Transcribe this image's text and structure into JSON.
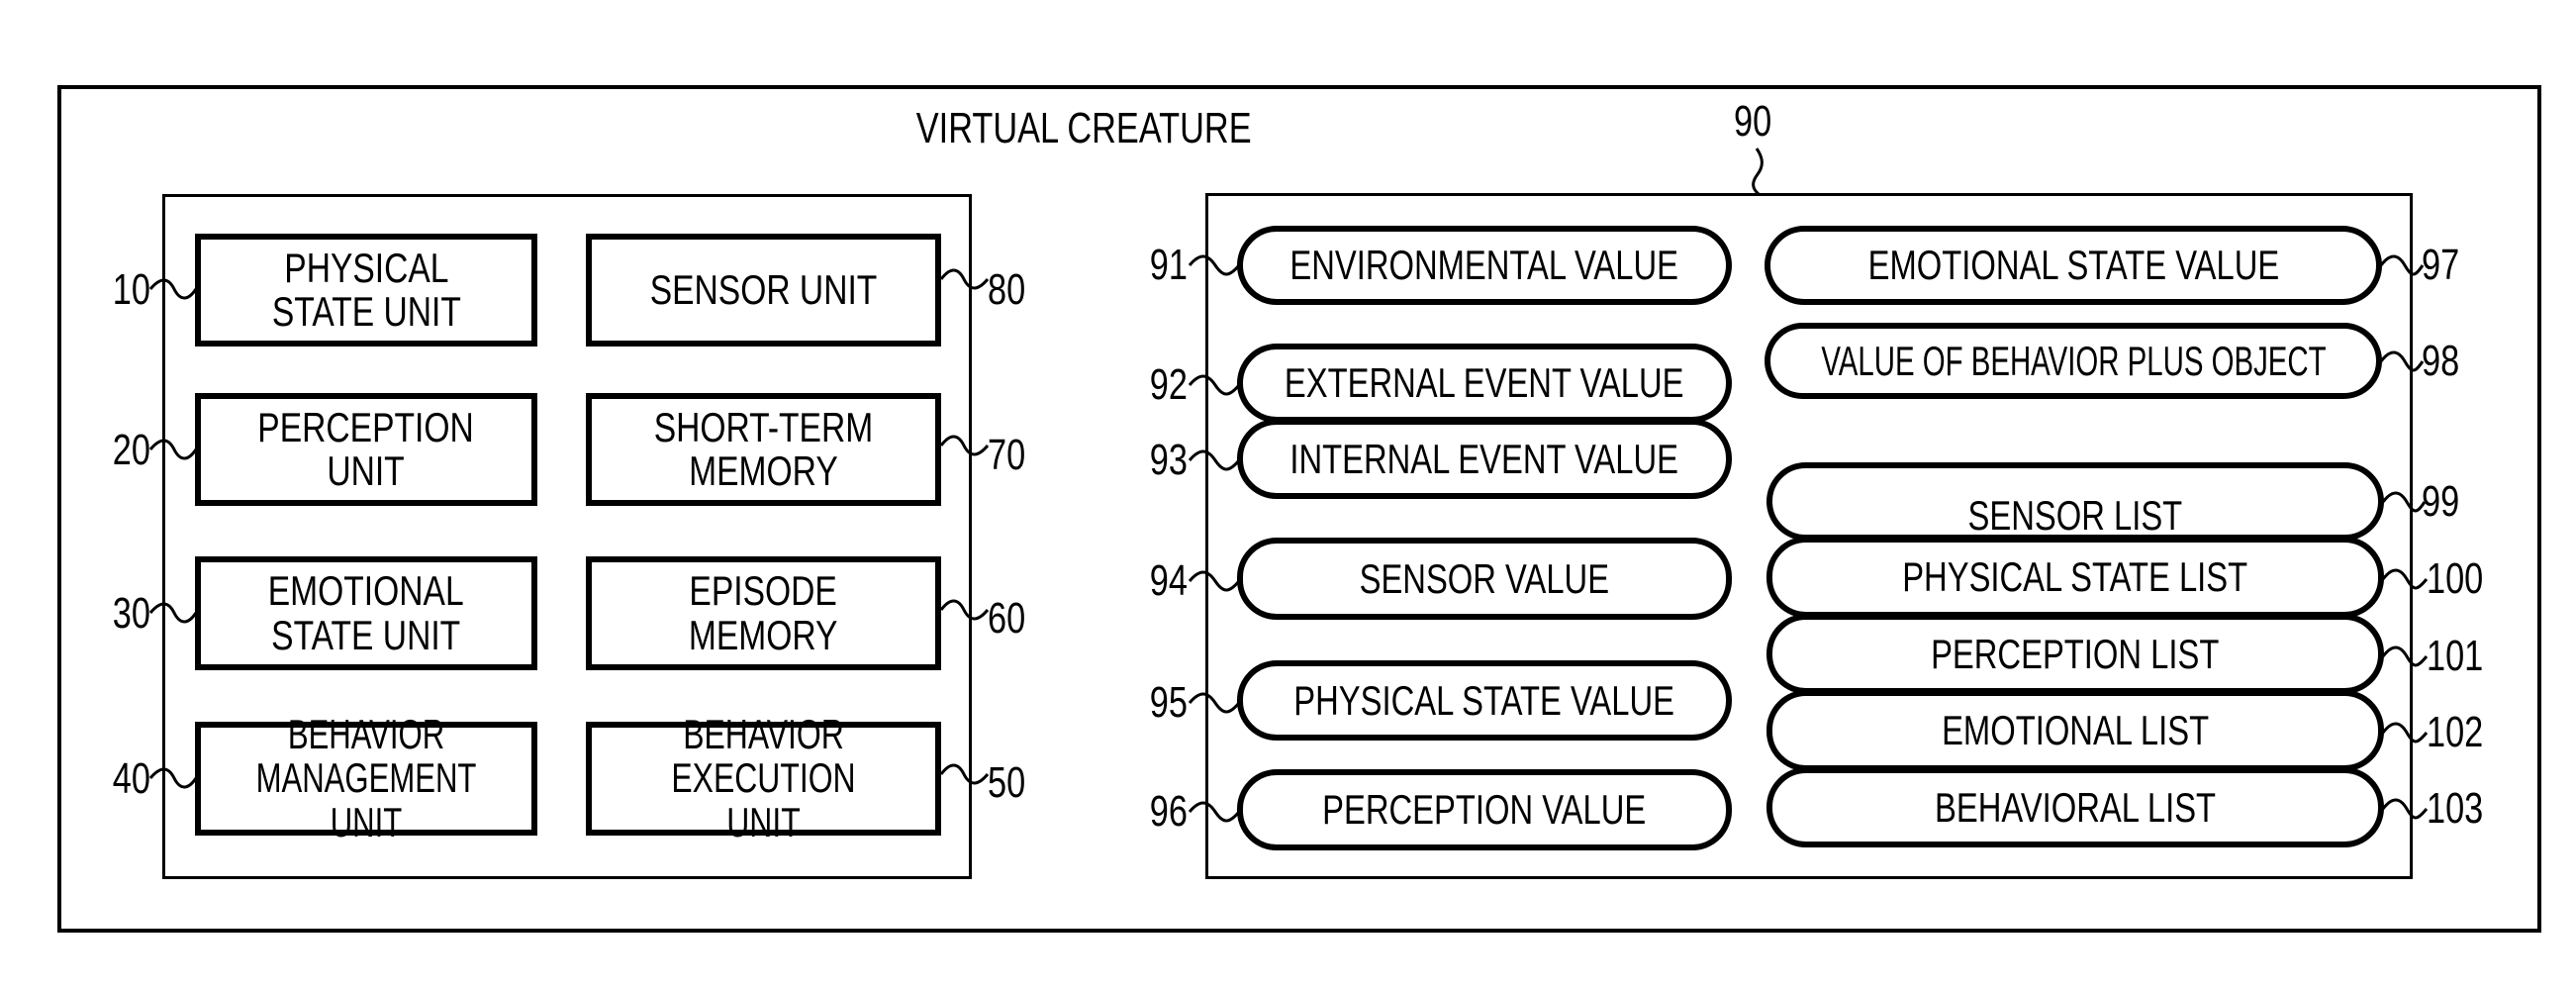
{
  "title": "VIRTUAL CREATURE",
  "left_group": {
    "units": [
      {
        "ref": "10",
        "label_lines": [
          "PHYSICAL",
          "STATE UNIT"
        ]
      },
      {
        "ref": "20",
        "label_lines": [
          "PERCEPTION",
          "UNIT"
        ]
      },
      {
        "ref": "30",
        "label_lines": [
          "EMOTIONAL",
          "STATE UNIT"
        ]
      },
      {
        "ref": "40",
        "label_lines": [
          "BEHAVIOR",
          "MANAGEMENT UNIT"
        ]
      },
      {
        "ref": "80",
        "label_lines": [
          "SENSOR UNIT"
        ]
      },
      {
        "ref": "70",
        "label_lines": [
          "SHORT-TERM",
          "MEMORY"
        ]
      },
      {
        "ref": "60",
        "label_lines": [
          "EPISODE",
          "MEMORY"
        ]
      },
      {
        "ref": "50",
        "label_lines": [
          "BEHAVIOR",
          "EXECUTION UNIT"
        ]
      }
    ]
  },
  "right_group": {
    "ref": "90",
    "values": [
      {
        "ref": "91",
        "label": "ENVIRONMENTAL VALUE"
      },
      {
        "ref": "92",
        "label": "EXTERNAL EVENT VALUE"
      },
      {
        "ref": "93",
        "label": "INTERNAL EVENT VALUE"
      },
      {
        "ref": "94",
        "label": "SENSOR VALUE"
      },
      {
        "ref": "95",
        "label": "PHYSICAL STATE VALUE"
      },
      {
        "ref": "96",
        "label": "PERCEPTION VALUE"
      },
      {
        "ref": "97",
        "label": "EMOTIONAL STATE VALUE"
      },
      {
        "ref": "98",
        "label": "VALUE OF BEHAVIOR PLUS OBJECT"
      }
    ],
    "lists": [
      {
        "ref": "99",
        "label": "SENSOR LIST"
      },
      {
        "ref": "100",
        "label": "PHYSICAL STATE LIST"
      },
      {
        "ref": "101",
        "label": "PERCEPTION LIST"
      },
      {
        "ref": "102",
        "label": "EMOTIONAL LIST"
      },
      {
        "ref": "103",
        "label": "BEHAVIORAL LIST"
      }
    ]
  }
}
